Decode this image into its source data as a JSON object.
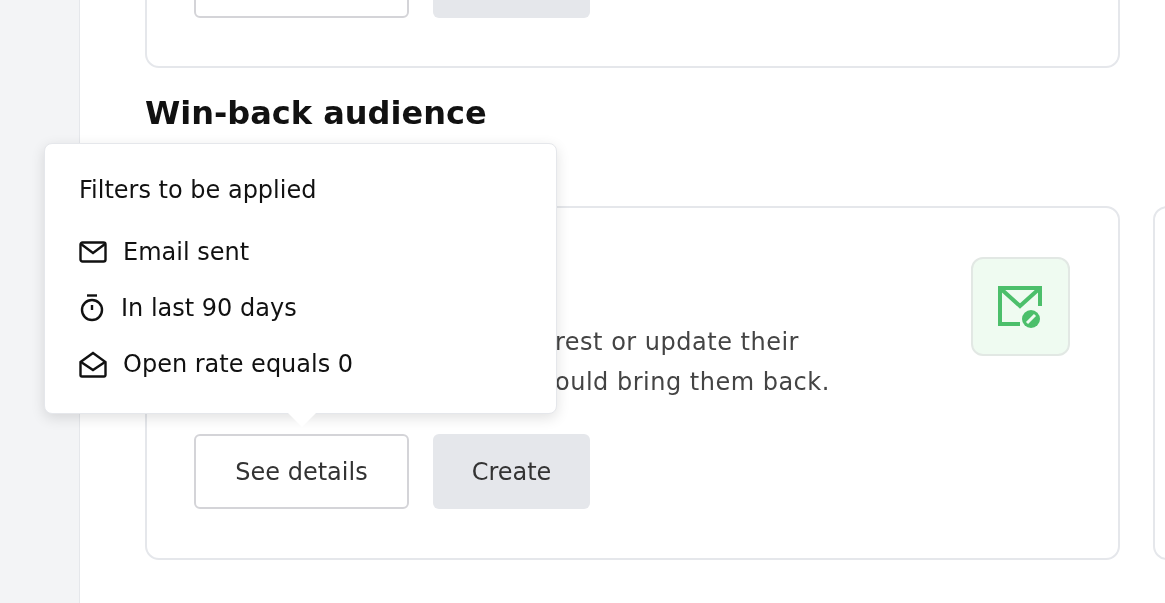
{
  "top_card": {
    "buttons": [
      {
        "kind": "outline"
      },
      {
        "kind": "filled"
      }
    ]
  },
  "section": {
    "title": "Win-back audience"
  },
  "card": {
    "description_lines": [
      "rest or update their",
      "ould bring them back."
    ],
    "buttons": [
      {
        "label": "See details",
        "kind": "outline"
      },
      {
        "label": "Create",
        "kind": "filled"
      }
    ]
  },
  "tooltip": {
    "title": "Filters to be applied",
    "filters": [
      {
        "kind": "mail",
        "label": "Email sent"
      },
      {
        "kind": "timer",
        "label": "In last 90 days"
      },
      {
        "kind": "open-mail",
        "label": "Open rate equals 0"
      }
    ]
  }
}
